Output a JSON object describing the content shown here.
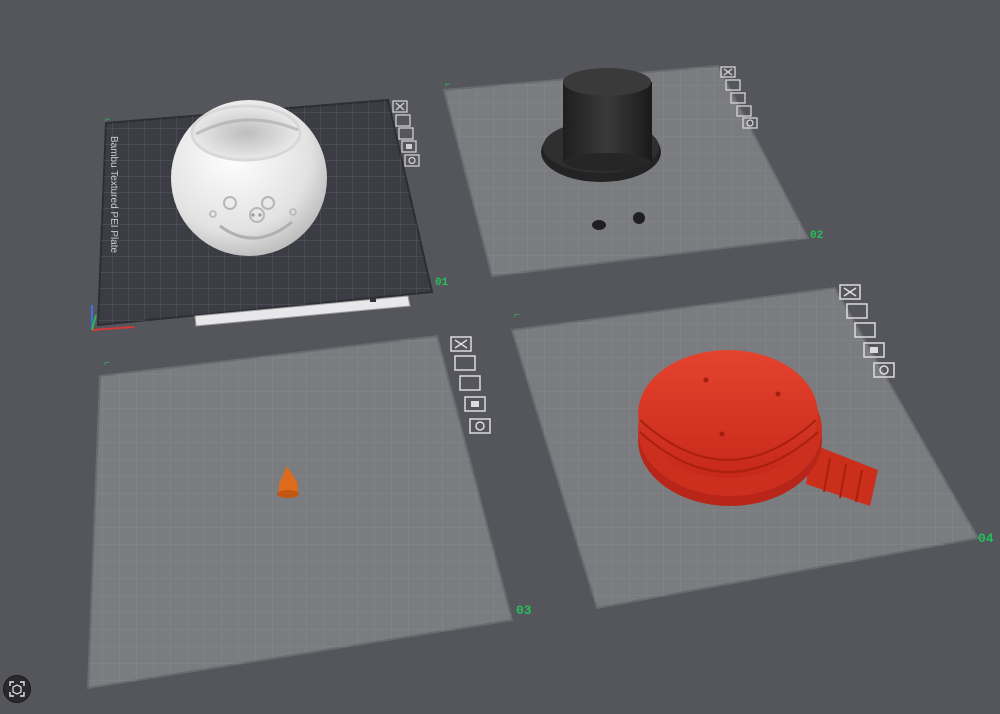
{
  "plates": [
    {
      "number": "01",
      "label": "Bambu Textured PEI Plate",
      "object": "pot with smiley face",
      "color": "#e7e7e7",
      "surface_color": "#3c3d44",
      "tools": [
        "close-icon",
        "arrange-icon",
        "layout-icon",
        "lock-icon",
        "settings-icon"
      ]
    },
    {
      "number": "02",
      "label": "",
      "object": "top hat and two eyes",
      "color": "#2b2b2b",
      "surface_color": "#7b7c80",
      "tools": [
        "close-icon",
        "arrange-icon",
        "layout-icon",
        "lock-icon",
        "settings-icon"
      ]
    },
    {
      "number": "03",
      "label": "",
      "object": "carrot nose",
      "color": "#dd6b1b",
      "surface_color": "#7b7c80",
      "tools": [
        "close-icon",
        "arrange-icon",
        "layout-icon",
        "lock-icon",
        "settings-icon"
      ]
    },
    {
      "number": "04",
      "label": "",
      "object": "lid with scarf",
      "color": "#d8321f",
      "surface_color": "#7b7c80",
      "tools": [
        "close-icon",
        "arrange-icon",
        "layout-icon",
        "lock-icon",
        "settings-icon"
      ]
    }
  ],
  "colors": {
    "background": "#55565b",
    "plate_number": "#21c15b",
    "grid_line": "#8e8f93"
  },
  "bottom_button": {
    "icon": "camera-reset-icon"
  }
}
